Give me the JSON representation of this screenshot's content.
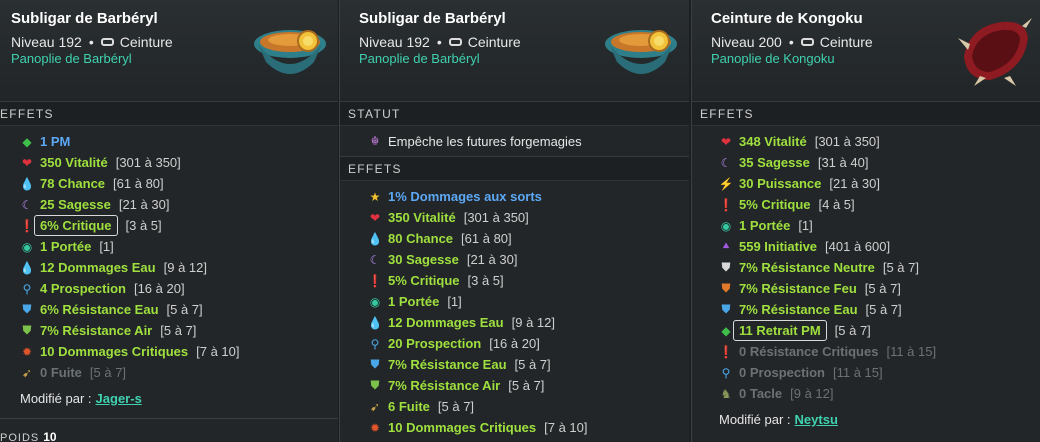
{
  "panels": [
    {
      "title": "Subligar de Barbéryl",
      "level": "Niveau 192",
      "slot": "Ceinture",
      "set": "Panoplie de Barbéryl",
      "effects_header": "EFFETS",
      "effects": [
        {
          "icon": "pm-icon",
          "value": "1 PM",
          "range": "",
          "tone": "blue"
        },
        {
          "icon": "vitality-icon",
          "value": "350 Vitalité",
          "range": "[301 à 350]",
          "tone": "green"
        },
        {
          "icon": "chance-icon",
          "value": "78 Chance",
          "range": "[61 à 80]",
          "tone": "green"
        },
        {
          "icon": "wisdom-icon",
          "value": "25 Sagesse",
          "range": "[21 à 30]",
          "tone": "green"
        },
        {
          "icon": "critical-icon",
          "value": "6% Critique",
          "range": "[3 à 5]",
          "tone": "green",
          "boxed": true
        },
        {
          "icon": "range-icon",
          "value": "1 Portée",
          "range": "[1]",
          "tone": "green"
        },
        {
          "icon": "water-damage-icon",
          "value": "12 Dommages Eau",
          "range": "[9 à 12]",
          "tone": "green"
        },
        {
          "icon": "prospection-icon",
          "value": "4 Prospection",
          "range": "[16 à 20]",
          "tone": "green"
        },
        {
          "icon": "water-resist-icon",
          "value": "6% Résistance Eau",
          "range": "[5 à 7]",
          "tone": "green"
        },
        {
          "icon": "air-resist-icon",
          "value": "7% Résistance Air",
          "range": "[5 à 7]",
          "tone": "green"
        },
        {
          "icon": "critical-damage-icon",
          "value": "10 Dommages Critiques",
          "range": "[7 à 10]",
          "tone": "green"
        },
        {
          "icon": "dodge-icon",
          "value": "0 Fuite",
          "range": "[5 à 7]",
          "tone": "grey"
        }
      ],
      "modified_label": "Modifié par :",
      "modified_by": "Jager-s",
      "weight_label": "POIDS",
      "weight_value": "10"
    },
    {
      "title": "Subligar de Barbéryl",
      "level": "Niveau 192",
      "slot": "Ceinture",
      "set": "Panoplie de Barbéryl",
      "status_header": "STATUT",
      "status_text": "Empêche les futures forgemagies",
      "effects_header": "EFFETS",
      "effects": [
        {
          "icon": "spell-damage-icon",
          "value": "1% Dommages aux sorts",
          "range": "",
          "tone": "blue"
        },
        {
          "icon": "vitality-icon",
          "value": "350 Vitalité",
          "range": "[301 à 350]",
          "tone": "green"
        },
        {
          "icon": "chance-icon",
          "value": "80 Chance",
          "range": "[61 à 80]",
          "tone": "green"
        },
        {
          "icon": "wisdom-icon",
          "value": "30 Sagesse",
          "range": "[21 à 30]",
          "tone": "green"
        },
        {
          "icon": "critical-icon",
          "value": "5% Critique",
          "range": "[3 à 5]",
          "tone": "green"
        },
        {
          "icon": "range-icon",
          "value": "1 Portée",
          "range": "[1]",
          "tone": "green"
        },
        {
          "icon": "water-damage-icon",
          "value": "12 Dommages Eau",
          "range": "[9 à 12]",
          "tone": "green"
        },
        {
          "icon": "prospection-icon",
          "value": "20 Prospection",
          "range": "[16 à 20]",
          "tone": "green"
        },
        {
          "icon": "water-resist-icon",
          "value": "7% Résistance Eau",
          "range": "[5 à 7]",
          "tone": "green"
        },
        {
          "icon": "air-resist-icon",
          "value": "7% Résistance Air",
          "range": "[5 à 7]",
          "tone": "green"
        },
        {
          "icon": "dodge-icon",
          "value": "6 Fuite",
          "range": "[5 à 7]",
          "tone": "green"
        },
        {
          "icon": "critical-damage-icon",
          "value": "10 Dommages Critiques",
          "range": "[7 à 10]",
          "tone": "green"
        }
      ]
    },
    {
      "title": "Ceinture de Kongoku",
      "level": "Niveau 200",
      "slot": "Ceinture",
      "set": "Panoplie de Kongoku",
      "effects_header": "EFFETS",
      "effects": [
        {
          "icon": "vitality-icon",
          "value": "348 Vitalité",
          "range": "[301 à 350]",
          "tone": "green"
        },
        {
          "icon": "wisdom-icon",
          "value": "35 Sagesse",
          "range": "[31 à 40]",
          "tone": "green"
        },
        {
          "icon": "power-icon",
          "value": "30 Puissance",
          "range": "[21 à 30]",
          "tone": "green"
        },
        {
          "icon": "critical-icon",
          "value": "5% Critique",
          "range": "[4 à 5]",
          "tone": "green"
        },
        {
          "icon": "range-icon",
          "value": "1 Portée",
          "range": "[1]",
          "tone": "green"
        },
        {
          "icon": "initiative-icon",
          "value": "559 Initiative",
          "range": "[401 à 600]",
          "tone": "green"
        },
        {
          "icon": "neutral-resist-icon",
          "value": "7% Résistance Neutre",
          "range": "[5 à 7]",
          "tone": "green"
        },
        {
          "icon": "fire-resist-icon",
          "value": "7% Résistance Feu",
          "range": "[5 à 7]",
          "tone": "green"
        },
        {
          "icon": "water-resist-icon",
          "value": "7% Résistance Eau",
          "range": "[5 à 7]",
          "tone": "green"
        },
        {
          "icon": "ap-reduction-icon",
          "value": "11 Retrait PM",
          "range": "[5 à 7]",
          "tone": "green",
          "boxed": true
        },
        {
          "icon": "critical-resist-icon",
          "value": "0 Résistance Critiques",
          "range": "[11 à 15]",
          "tone": "grey"
        },
        {
          "icon": "prospection-icon",
          "value": "0 Prospection",
          "range": "[11 à 15]",
          "tone": "grey"
        },
        {
          "icon": "lock-icon",
          "value": "0 Tacle",
          "range": "[9 à 12]",
          "tone": "grey"
        }
      ],
      "modified_label": "Modifié par :",
      "modified_by": "Neytsu"
    }
  ],
  "icon_glyphs": {
    "pm-icon": {
      "char": "◆",
      "color": "#3fbf4a"
    },
    "vitality-icon": {
      "char": "❤",
      "color": "#e0313f"
    },
    "chance-icon": {
      "char": "💧",
      "color": "#5aa9e6"
    },
    "wisdom-icon": {
      "char": "☾",
      "color": "#b98cf0"
    },
    "critical-icon": {
      "char": "❗",
      "color": "#e02a2a"
    },
    "range-icon": {
      "char": "◉",
      "color": "#35c7a0"
    },
    "water-damage-icon": {
      "char": "💧",
      "color": "#5aa9e6"
    },
    "prospection-icon": {
      "char": "⚲",
      "color": "#4aa8e8"
    },
    "water-resist-icon": {
      "char": "⛊",
      "color": "#4aa8e8"
    },
    "air-resist-icon": {
      "char": "⛊",
      "color": "#7cc24a"
    },
    "critical-damage-icon": {
      "char": "✹",
      "color": "#e0552a"
    },
    "dodge-icon": {
      "char": "➹",
      "color": "#c8a04a"
    },
    "spell-damage-icon": {
      "char": "★",
      "color": "#f2c22e"
    },
    "power-icon": {
      "char": "⚡",
      "color": "#f2c22e"
    },
    "initiative-icon": {
      "char": "⯅",
      "color": "#a05ae0"
    },
    "neutral-resist-icon": {
      "char": "⛊",
      "color": "#d8d8d8"
    },
    "fire-resist-icon": {
      "char": "⛊",
      "color": "#e07a2a"
    },
    "ap-reduction-icon": {
      "char": "◆",
      "color": "#3fbf4a"
    },
    "critical-resist-icon": {
      "char": "❗",
      "color": "#7a3a3a"
    },
    "lock-icon": {
      "char": "♞",
      "color": "#8a9a5a"
    }
  },
  "colors": {
    "accent": "#3fd1b0",
    "value_green": "#9fe03f",
    "value_blue": "#5da8f5",
    "muted": "#6c7174"
  }
}
